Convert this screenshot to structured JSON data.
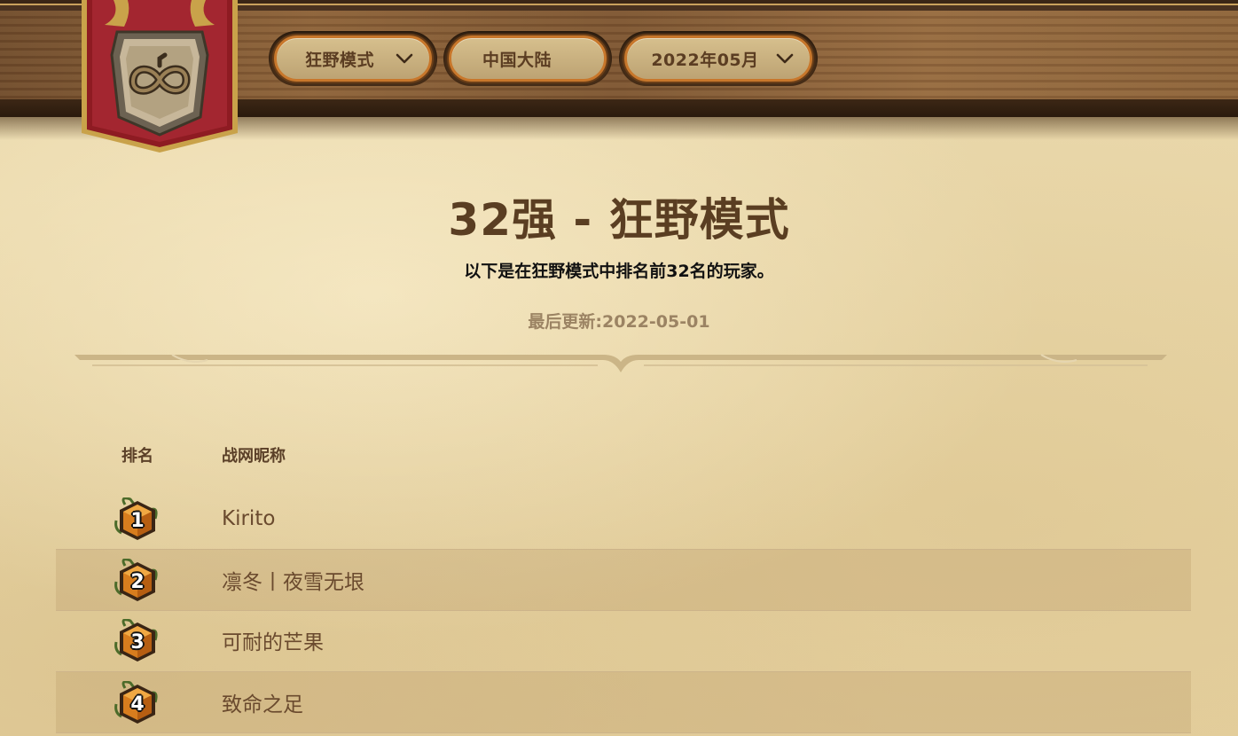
{
  "filters": {
    "mode": {
      "label": "狂野模式",
      "icon": "chevron-down-icon"
    },
    "region": {
      "label": "中国大陆"
    },
    "month": {
      "label": "2022年05月",
      "icon": "chevron-down-icon"
    }
  },
  "emblem": {
    "icon": "wild-infinity-emblem-icon"
  },
  "page": {
    "title": "32强 - 狂野模式",
    "subtitle": "以下是在狂野模式中排名前32名的玩家。",
    "last_updated": "最后更新:2022-05-01"
  },
  "table": {
    "headers": {
      "rank": "排名",
      "name": "战网昵称"
    },
    "rows": [
      {
        "rank": "1",
        "name": "Kirito"
      },
      {
        "rank": "2",
        "name": "凛冬丨夜雪无垠"
      },
      {
        "rank": "3",
        "name": "可耐的芒果"
      },
      {
        "rank": "4",
        "name": "致命之足"
      }
    ]
  },
  "colors": {
    "parchment": "#e8d6a8",
    "wood": "#7b5431",
    "title": "#5a3e22",
    "banner_red": "#8e1b22",
    "pill_border": "#c8772b"
  }
}
